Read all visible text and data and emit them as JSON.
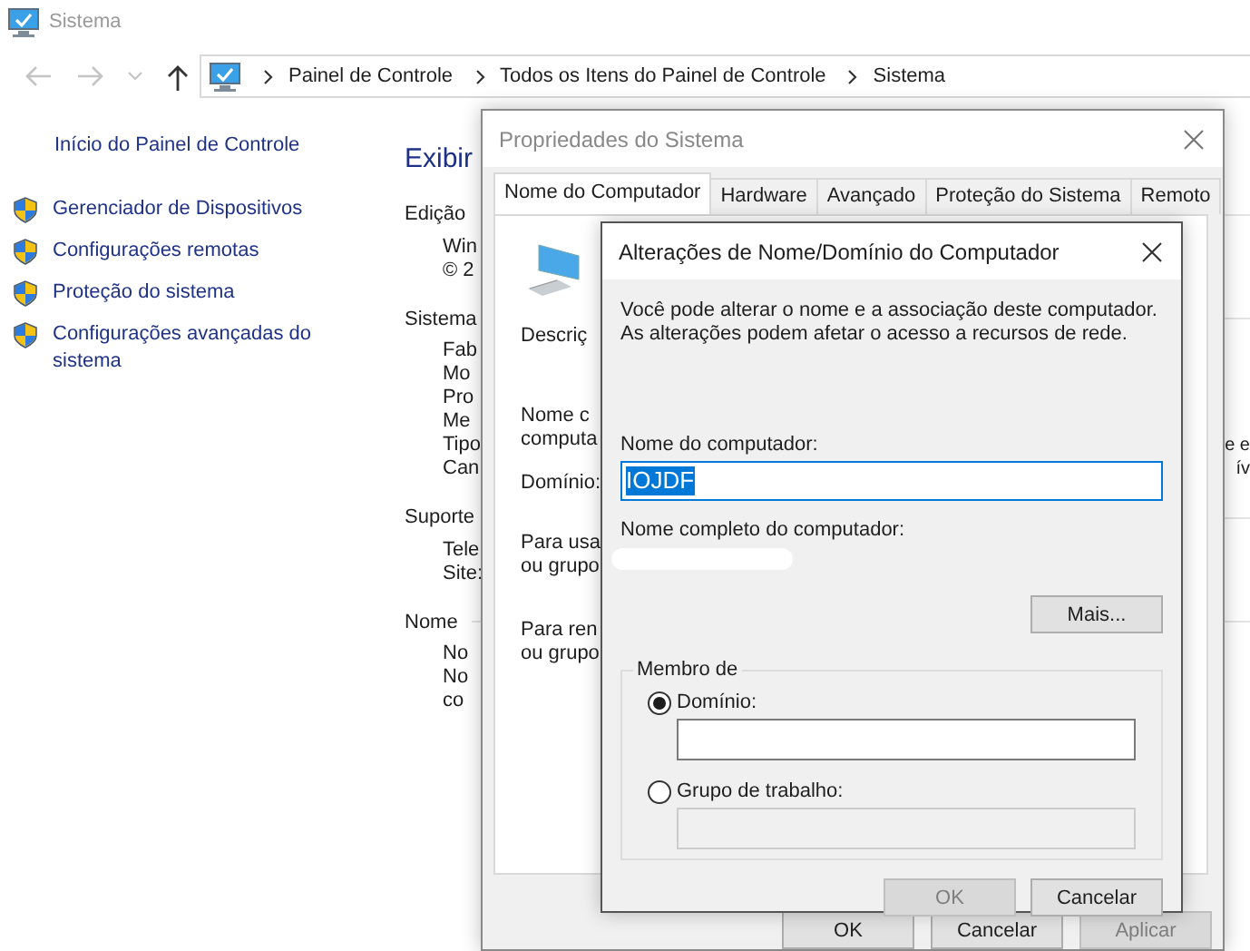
{
  "window": {
    "title": "Sistema"
  },
  "address_bar": {
    "path": [
      "Painel de Controle",
      "Todos os Itens do Painel de Controle",
      "Sistema"
    ]
  },
  "sidebar": {
    "home_link": "Início do Painel de Controle",
    "items": [
      {
        "label": "Gerenciador de Dispositivos"
      },
      {
        "label": "Configurações remotas"
      },
      {
        "label": "Proteção do sistema"
      },
      {
        "label": "Configurações avançadas do sistema"
      }
    ]
  },
  "main": {
    "lines": [
      {
        "kind": "title",
        "text": "Exibir"
      },
      {
        "kind": "section",
        "text": "Edição"
      },
      {
        "kind": "item",
        "text": "Win"
      },
      {
        "kind": "item",
        "text": "© 2"
      },
      {
        "kind": "section",
        "text": "Sistema"
      },
      {
        "kind": "item",
        "text": "Fab"
      },
      {
        "kind": "item",
        "text": "Mo"
      },
      {
        "kind": "item",
        "text": "Pro"
      },
      {
        "kind": "item",
        "text": "Me"
      },
      {
        "kind": "item",
        "text": "Tipo",
        "end_text": "e e"
      },
      {
        "kind": "item",
        "text": "Can",
        "end_text": "ív"
      },
      {
        "kind": "section",
        "text": "Suporte"
      },
      {
        "kind": "item",
        "text": "Tele"
      },
      {
        "kind": "item",
        "text": "Site:"
      },
      {
        "kind": "section",
        "text": "Nome"
      },
      {
        "kind": "item",
        "text": "No"
      },
      {
        "kind": "item",
        "text": "No\nco"
      }
    ]
  },
  "system_properties": {
    "title": "Propriedades do Sistema",
    "tabs": [
      {
        "label": "Nome do Computador",
        "selected": true
      },
      {
        "label": "Hardware",
        "selected": false
      },
      {
        "label": "Avançado",
        "selected": false
      },
      {
        "label": "Proteção do Sistema",
        "selected": false
      },
      {
        "label": "Remoto",
        "selected": false
      }
    ],
    "lines": [
      {
        "kind": "description",
        "text": "Descriç"
      },
      {
        "kind": "field",
        "text": "Nome c\ncomputa"
      },
      {
        "kind": "field",
        "text": "Domínio:"
      },
      {
        "kind": "note",
        "text": "Para usa\nou grupo"
      },
      {
        "kind": "note",
        "text": "Para ren\nou grupo"
      }
    ],
    "buttons": [
      {
        "label": "OK",
        "disabled": false
      },
      {
        "label": "Cancelar",
        "disabled": false
      },
      {
        "label": "Aplicar",
        "disabled": true
      }
    ]
  },
  "name_dialog": {
    "title": "Alterações de Nome/Domínio do Computador",
    "description": "Você pode alterar o nome e a associação deste computador.\nAs alterações podem afetar o acesso a recursos de rede.",
    "computer_name": {
      "label": "Nome do computador:",
      "value": "IOJDF"
    },
    "full_name_label": "Nome completo do computador:",
    "more_button": "Mais...",
    "member_of": {
      "legend": "Membro de",
      "options": [
        {
          "label": "Domínio:",
          "selected": true
        },
        {
          "label": "Grupo de trabalho:",
          "selected": false
        }
      ]
    },
    "buttons": [
      {
        "label": "OK",
        "disabled": true
      },
      {
        "label": "Cancelar",
        "disabled": false
      }
    ]
  }
}
